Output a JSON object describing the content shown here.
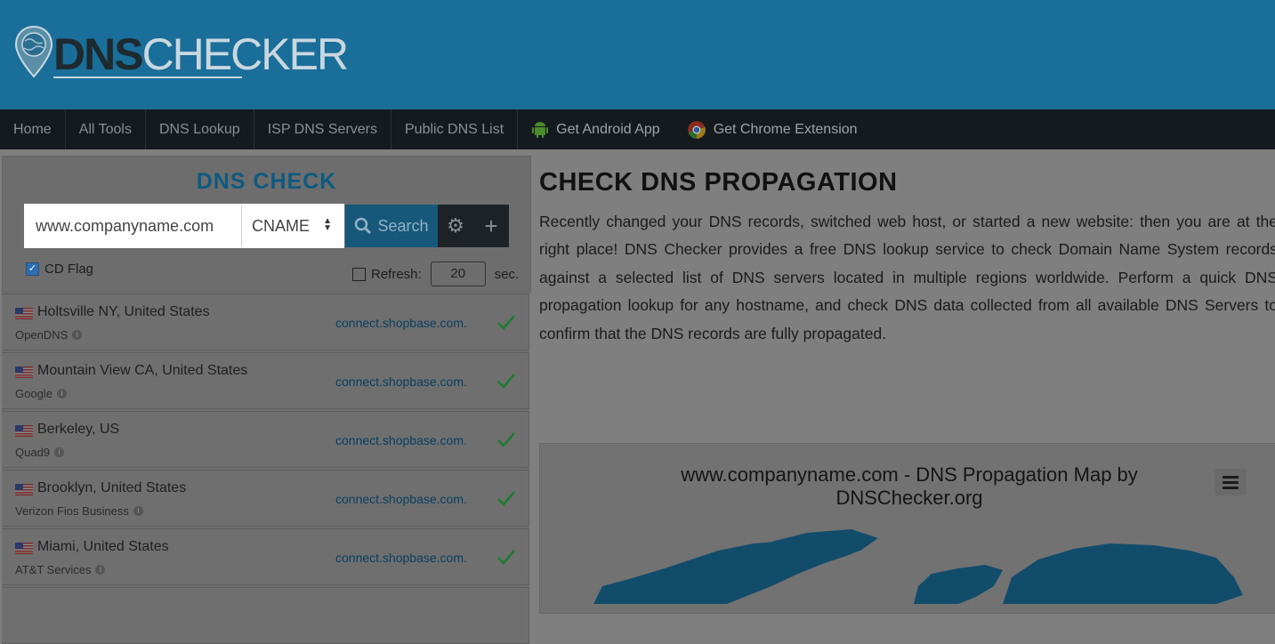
{
  "logo": {
    "part1": "DNS",
    "part2": "CHECKER"
  },
  "nav": {
    "items": [
      "Home",
      "All Tools",
      "DNS Lookup",
      "ISP DNS Servers",
      "Public DNS List"
    ],
    "android": "Get Android App",
    "chrome": "Get Chrome Extension"
  },
  "dns_check": {
    "title": "DNS CHECK",
    "domain_value": "www.companyname.com",
    "record_type": "CNAME",
    "search_label": "Search",
    "cd_flag_label": "CD Flag",
    "cd_flag_checked": true,
    "refresh_label": "Refresh:",
    "refresh_value": "20",
    "refresh_unit": "sec."
  },
  "results": [
    {
      "location": "Holtsville NY, United States",
      "provider": "OpenDNS",
      "result": "connect.shopbase.com."
    },
    {
      "location": "Mountain View CA, United States",
      "provider": "Google",
      "result": "connect.shopbase.com."
    },
    {
      "location": "Berkeley, US",
      "provider": "Quad9",
      "result": "connect.shopbase.com."
    },
    {
      "location": "Brooklyn, United States",
      "provider": "Verizon Fios Business",
      "result": "connect.shopbase.com."
    },
    {
      "location": "Miami, United States",
      "provider": "AT&T Services",
      "result": "connect.shopbase.com."
    }
  ],
  "main": {
    "heading": "CHECK DNS PROPAGATION",
    "paragraph": "Recently changed your DNS records, switched web host, or started a new website: then you are at the right place! DNS Checker provides a free DNS lookup service to check Domain Name System records against a selected list of DNS servers located in multiple regions worldwide. Perform a quick DNS propagation lookup for any hostname, and check DNS data collected from all available DNS Servers to confirm that the DNS records are fully propagated.",
    "map_title_line1": "www.companyname.com - DNS Propagation Map by",
    "map_title_line2": "DNSChecker.org"
  },
  "colors": {
    "header": "#1a6e9a",
    "nav": "#141a1e",
    "accent": "#17577a",
    "check": "#1e7a33"
  },
  "icons": [
    "globe-pin-icon",
    "android-icon",
    "chrome-icon",
    "search-icon",
    "gear-icon",
    "plus-icon",
    "us-flag-icon",
    "info-icon",
    "check-icon",
    "hamburger-menu-icon"
  ]
}
